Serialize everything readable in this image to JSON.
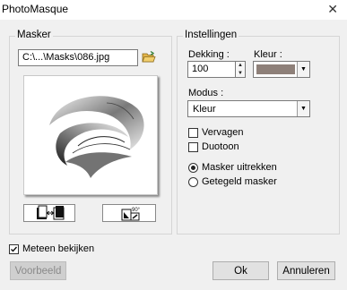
{
  "window": {
    "title": "PhotoMasque",
    "close_glyph": "✕"
  },
  "masker": {
    "group_label": "Masker",
    "file_path": "C:\\...\\Masks\\086.jpg",
    "open_icon": "folder-open-icon",
    "swap_icon": "invert-mask-icon",
    "rotate_icon": "rotate-90-icon",
    "rotate_text": "90°"
  },
  "instellingen": {
    "group_label": "Instellingen",
    "dekking_label": "Dekking :",
    "dekking_value": "100",
    "kleur_label": "Kleur :",
    "kleur_color": "#8e8079",
    "modus_label": "Modus :",
    "modus_value": "Kleur",
    "vervagen_label": "Vervagen",
    "vervagen_checked": false,
    "duotoon_label": "Duotoon",
    "duotoon_checked": false,
    "radio_stretch_label": "Masker uitrekken",
    "radio_tile_label": "Getegeld masker",
    "selected_radio": "Masker uitrekken"
  },
  "meteen_label": "Meteen bekijken",
  "meteen_checked": true,
  "buttons": {
    "voorbeeld": "Voorbeeld",
    "ok": "Ok",
    "annuleren": "Annuleren"
  }
}
